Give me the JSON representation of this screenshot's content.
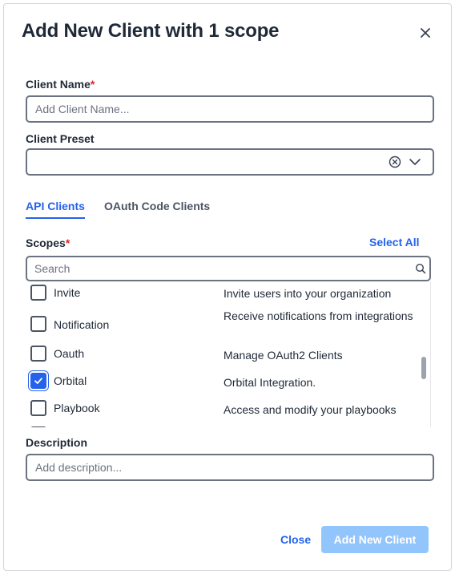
{
  "dialog": {
    "title": "Add New Client with 1 scope"
  },
  "client_name": {
    "label": "Client Name",
    "required_mark": "*",
    "placeholder": "Add Client Name...",
    "value": ""
  },
  "client_preset": {
    "label": "Client Preset",
    "value": ""
  },
  "tabs": [
    {
      "label": "API Clients",
      "active": true
    },
    {
      "label": "OAuth Code Clients",
      "active": false
    }
  ],
  "scopes": {
    "label": "Scopes",
    "required_mark": "*",
    "select_all_label": "Select All",
    "search_placeholder": "Search",
    "items": [
      {
        "name": "Invite",
        "description": "Invite users into your organization",
        "checked": false
      },
      {
        "name": "Notification",
        "description": "Receive notifications from integrations",
        "checked": false
      },
      {
        "name": "Oauth",
        "description": "Manage OAuth2 Clients",
        "checked": false
      },
      {
        "name": "Orbital",
        "description": "Orbital Integration.",
        "checked": true
      },
      {
        "name": "Playbook",
        "description": "Access and modify your playbooks",
        "checked": false
      }
    ]
  },
  "description": {
    "label": "Description",
    "placeholder": "Add description..."
  },
  "footer": {
    "close_label": "Close",
    "add_label": "Add New Client"
  },
  "colors": {
    "accent": "#2563eb",
    "required": "#dc2626",
    "disabled_button": "#93c5fd"
  }
}
